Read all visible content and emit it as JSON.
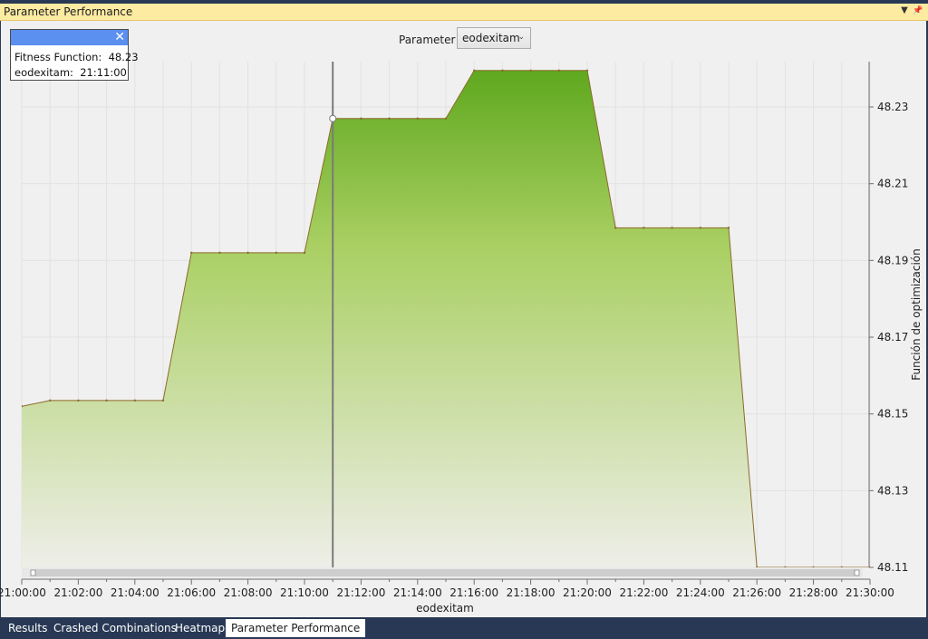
{
  "window": {
    "title": "Parameter Performance"
  },
  "title_buttons": {
    "dropdown_icon": "▼",
    "pin_icon": "📌"
  },
  "parameter": {
    "label": "Parameter",
    "selected": "eodexitam"
  },
  "tooltip": {
    "line1": "Fitness Function:  48.23",
    "line2": "eodexitam:  21:11:00",
    "close": "✕"
  },
  "colors": {
    "fill_top": "#5fa81e",
    "fill_bottom": "#eeeee8",
    "stroke": "#8b6a2a",
    "accent": "#5b8ff0"
  },
  "chart_data": {
    "type": "area",
    "x": [
      "21:00:00",
      "21:01:00",
      "21:02:00",
      "21:03:00",
      "21:04:00",
      "21:05:00",
      "21:06:00",
      "21:07:00",
      "21:08:00",
      "21:09:00",
      "21:10:00",
      "21:11:00",
      "21:12:00",
      "21:13:00",
      "21:14:00",
      "21:15:00",
      "21:16:00",
      "21:17:00",
      "21:18:00",
      "21:19:00",
      "21:20:00",
      "21:21:00",
      "21:22:00",
      "21:23:00",
      "21:24:00",
      "21:25:00",
      "21:26:00",
      "21:27:00",
      "21:28:00",
      "21:29:00",
      "21:30:00"
    ],
    "values": [
      48.152,
      48.1535,
      48.1535,
      48.1535,
      48.1535,
      48.1535,
      48.192,
      48.192,
      48.192,
      48.192,
      48.192,
      48.227,
      48.227,
      48.227,
      48.227,
      48.227,
      48.2395,
      48.2395,
      48.2395,
      48.2395,
      48.2395,
      48.1985,
      48.1985,
      48.1985,
      48.1985,
      48.1985,
      48.11,
      48.11,
      48.11,
      48.11,
      48.11
    ],
    "xticks": [
      "21:00:00",
      "21:02:00",
      "21:04:00",
      "21:06:00",
      "21:08:00",
      "21:10:00",
      "21:12:00",
      "21:14:00",
      "21:16:00",
      "21:18:00",
      "21:20:00",
      "21:22:00",
      "21:24:00",
      "21:26:00",
      "21:28:00",
      "21:30:00"
    ],
    "yticks": [
      "48.11",
      "48.13",
      "48.15",
      "48.17",
      "48.19",
      "48.21",
      "48.23"
    ],
    "xlabel": "eodexitam",
    "ylabel": "Función de optimización",
    "ylim": [
      48.11,
      48.2395
    ],
    "crosshair_x": "21:11:00",
    "grid": true
  },
  "tabs": [
    {
      "label": "Results",
      "active": false
    },
    {
      "label": "Crashed Combinations",
      "active": false
    },
    {
      "label": "Heatmap",
      "active": false
    },
    {
      "label": "Parameter Performance",
      "active": true
    }
  ]
}
